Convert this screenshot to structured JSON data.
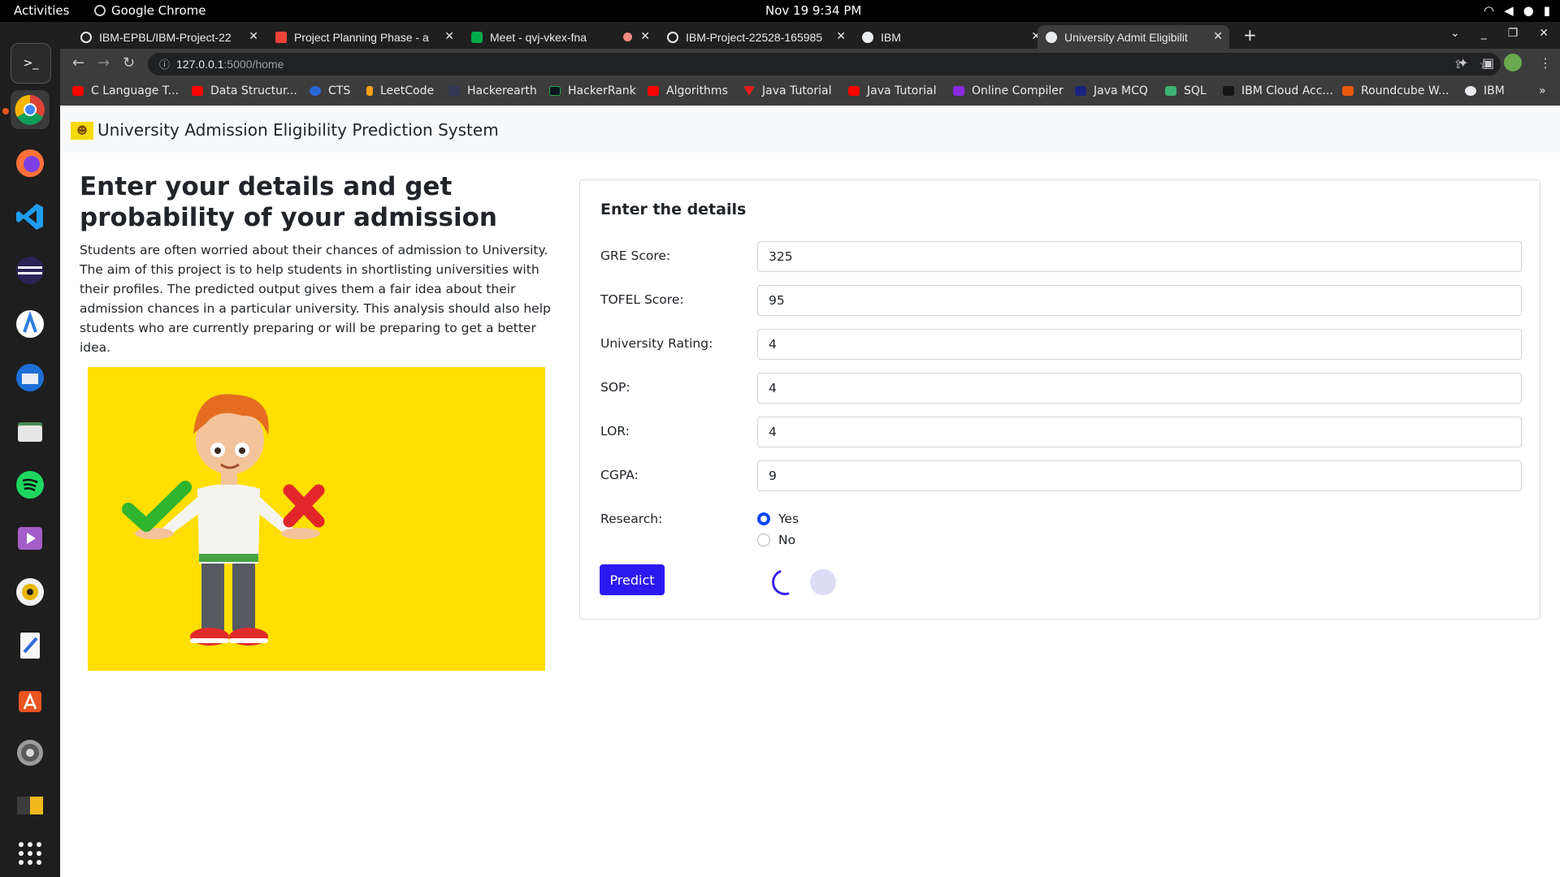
{
  "system": {
    "activities": "Activities",
    "app_name": "Google Chrome",
    "clock": "Nov 19  9:34 PM"
  },
  "browser": {
    "tabs": [
      {
        "title": "IBM-EPBL/IBM-Project-22",
        "icon": "github-icon"
      },
      {
        "title": "Project Planning Phase - a",
        "icon": "gmail-icon"
      },
      {
        "title": "Meet - qvj-vkex-fna",
        "icon": "google-meet-icon"
      },
      {
        "title": "IBM-Project-22528-165985",
        "icon": "github-icon"
      },
      {
        "title": "IBM",
        "icon": "globe-icon"
      },
      {
        "title": "University Admit Eligibilit",
        "icon": "globe-icon",
        "active": true
      }
    ],
    "url_host": "127.0.0.1",
    "url_path": ":5000/home",
    "bookmarks": [
      {
        "label": "C Language T...",
        "icon": "youtube-icon"
      },
      {
        "label": "Data Structur...",
        "icon": "youtube-icon"
      },
      {
        "label": "CTS",
        "icon": "cts-icon"
      },
      {
        "label": "LeetCode",
        "icon": "leetcode-icon"
      },
      {
        "label": "Hackerearth",
        "icon": "hackerearth-icon"
      },
      {
        "label": "HackerRank",
        "icon": "hackerrank-icon"
      },
      {
        "label": "Algorithms",
        "icon": "youtube-icon"
      },
      {
        "label": "Java Tutorial",
        "icon": "java-icon"
      },
      {
        "label": "Java Tutorial",
        "icon": "youtube-icon"
      },
      {
        "label": "Online Compiler",
        "icon": "compiler-icon"
      },
      {
        "label": "Java MCQ",
        "icon": "java-mcq-icon"
      },
      {
        "label": "SQL",
        "icon": "sql-icon"
      },
      {
        "label": "IBM Cloud Acc...",
        "icon": "ibm-cloud-icon"
      },
      {
        "label": "Roundcube W...",
        "icon": "roundcube-icon"
      },
      {
        "label": "IBM",
        "icon": "globe-icon"
      }
    ]
  },
  "app": {
    "brand": "University Admission Eligibility Prediction System",
    "hero_title": "Enter your details and get probability of your admission",
    "hero_text": "Students are often worried about their chances of admission to University. The aim of this project is to help students in shortlisting universities with their profiles. The predicted output gives them a fair idea about their admission chances in a particular university. This analysis should also help students who are currently preparing or will be preparing to get a better idea.",
    "form_title": "Enter the details",
    "fields": [
      {
        "label": "GRE Score:",
        "value": "325"
      },
      {
        "label": "TOFEL Score:",
        "value": "95"
      },
      {
        "label": "University Rating:",
        "value": "4"
      },
      {
        "label": "SOP:",
        "value": "4"
      },
      {
        "label": "LOR:",
        "value": "4"
      },
      {
        "label": "CGPA:",
        "value": "9"
      }
    ],
    "research_label": "Research:",
    "research_options": [
      "Yes",
      "No"
    ],
    "research_selected": "Yes",
    "predict_label": "Predict"
  },
  "colors": {
    "primary_button": "#2c19f0",
    "hero_background": "#ffdf00",
    "check_green": "#2fb52f",
    "cross_red": "#e3262a"
  }
}
